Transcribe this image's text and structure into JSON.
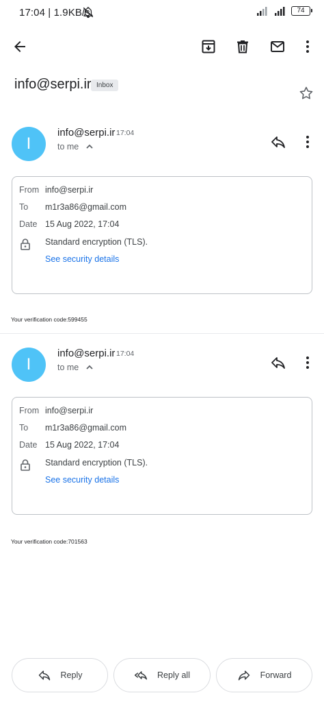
{
  "status_bar": {
    "time_speed": "17:04 | 1.9KB/s",
    "battery": "74"
  },
  "app_bar": {
    "back_icon": "arrow-back-icon",
    "archive_icon": "archive-icon",
    "delete_icon": "trash-icon",
    "mark_unread_icon": "mail-icon",
    "more_icon": "more-vertical-icon"
  },
  "thread": {
    "subject": "info@serpi.ir",
    "label": "Inbox"
  },
  "messages": [
    {
      "avatar_letter": "I",
      "sender": "info@serpi.ir",
      "time": "17:04",
      "to_summary": "to me",
      "details": {
        "from_label": "From",
        "from_value": "info@serpi.ir",
        "to_label": "To",
        "to_value": "m1r3a86@gmail.com",
        "date_label": "Date",
        "date_value": "15 Aug 2022, 17:04",
        "encryption": "Standard encryption (TLS).",
        "security_link": "See security details"
      },
      "body": "Your verification code:599455"
    },
    {
      "avatar_letter": "I",
      "sender": "info@serpi.ir",
      "time": "17:04",
      "to_summary": "to me",
      "details": {
        "from_label": "From",
        "from_value": "info@serpi.ir",
        "to_label": "To",
        "to_value": "m1r3a86@gmail.com",
        "date_label": "Date",
        "date_value": "15 Aug 2022, 17:04",
        "encryption": "Standard encryption (TLS).",
        "security_link": "See security details"
      },
      "body": "Your verification code:701563"
    }
  ],
  "actions": {
    "reply": "Reply",
    "reply_all": "Reply all",
    "forward": "Forward"
  },
  "colors": {
    "avatar": "#4fc3f7",
    "link": "#1a73e8"
  }
}
